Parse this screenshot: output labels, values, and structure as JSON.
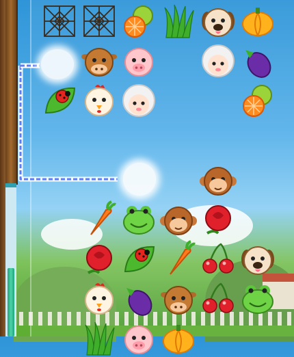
{
  "game": {
    "board": {
      "rows": 9,
      "cols": 6,
      "tiles": [
        {
          "row": 0,
          "col": 0,
          "type": "spider-web"
        },
        {
          "row": 0,
          "col": 1,
          "type": "spider-web"
        },
        {
          "row": 0,
          "col": 2,
          "type": "lime-orange"
        },
        {
          "row": 0,
          "col": 3,
          "type": "grass"
        },
        {
          "row": 0,
          "col": 4,
          "type": "dog"
        },
        {
          "row": 0,
          "col": 5,
          "type": "pumpkin"
        },
        {
          "row": 1,
          "col": 1,
          "type": "cow"
        },
        {
          "row": 1,
          "col": 2,
          "type": "pig"
        },
        {
          "row": 1,
          "col": 4,
          "type": "sheep"
        },
        {
          "row": 1,
          "col": 5,
          "type": "eggplant"
        },
        {
          "row": 2,
          "col": 0,
          "type": "ladybug-leaf"
        },
        {
          "row": 2,
          "col": 1,
          "type": "chicken"
        },
        {
          "row": 2,
          "col": 2,
          "type": "sheep"
        },
        {
          "row": 2,
          "col": 5,
          "type": "lime-orange"
        },
        {
          "row": 4,
          "col": 4,
          "type": "monkey"
        },
        {
          "row": 5,
          "col": 1,
          "type": "carrot"
        },
        {
          "row": 5,
          "col": 2,
          "type": "frog"
        },
        {
          "row": 5,
          "col": 3,
          "type": "monkey"
        },
        {
          "row": 5,
          "col": 4,
          "type": "rose"
        },
        {
          "row": 6,
          "col": 1,
          "type": "rose"
        },
        {
          "row": 6,
          "col": 2,
          "type": "ladybug-leaf"
        },
        {
          "row": 6,
          "col": 3,
          "type": "carrot"
        },
        {
          "row": 6,
          "col": 4,
          "type": "cherries"
        },
        {
          "row": 6,
          "col": 5,
          "type": "dog"
        },
        {
          "row": 7,
          "col": 1,
          "type": "chicken"
        },
        {
          "row": 7,
          "col": 2,
          "type": "eggplant"
        },
        {
          "row": 7,
          "col": 3,
          "type": "cow"
        },
        {
          "row": 7,
          "col": 4,
          "type": "cherries"
        },
        {
          "row": 7,
          "col": 5,
          "type": "frog"
        },
        {
          "row": 8,
          "col": 1,
          "type": "grass"
        },
        {
          "row": 8,
          "col": 2,
          "type": "pig"
        },
        {
          "row": 8,
          "col": 3,
          "type": "pumpkin"
        }
      ]
    },
    "timer": {
      "remaining_fraction": 0.45
    },
    "colors": {
      "sky": "#3a9fe0",
      "grass": "#5fae34",
      "timer_bar": "#34c59a",
      "lightning": "#5b7cff"
    }
  }
}
